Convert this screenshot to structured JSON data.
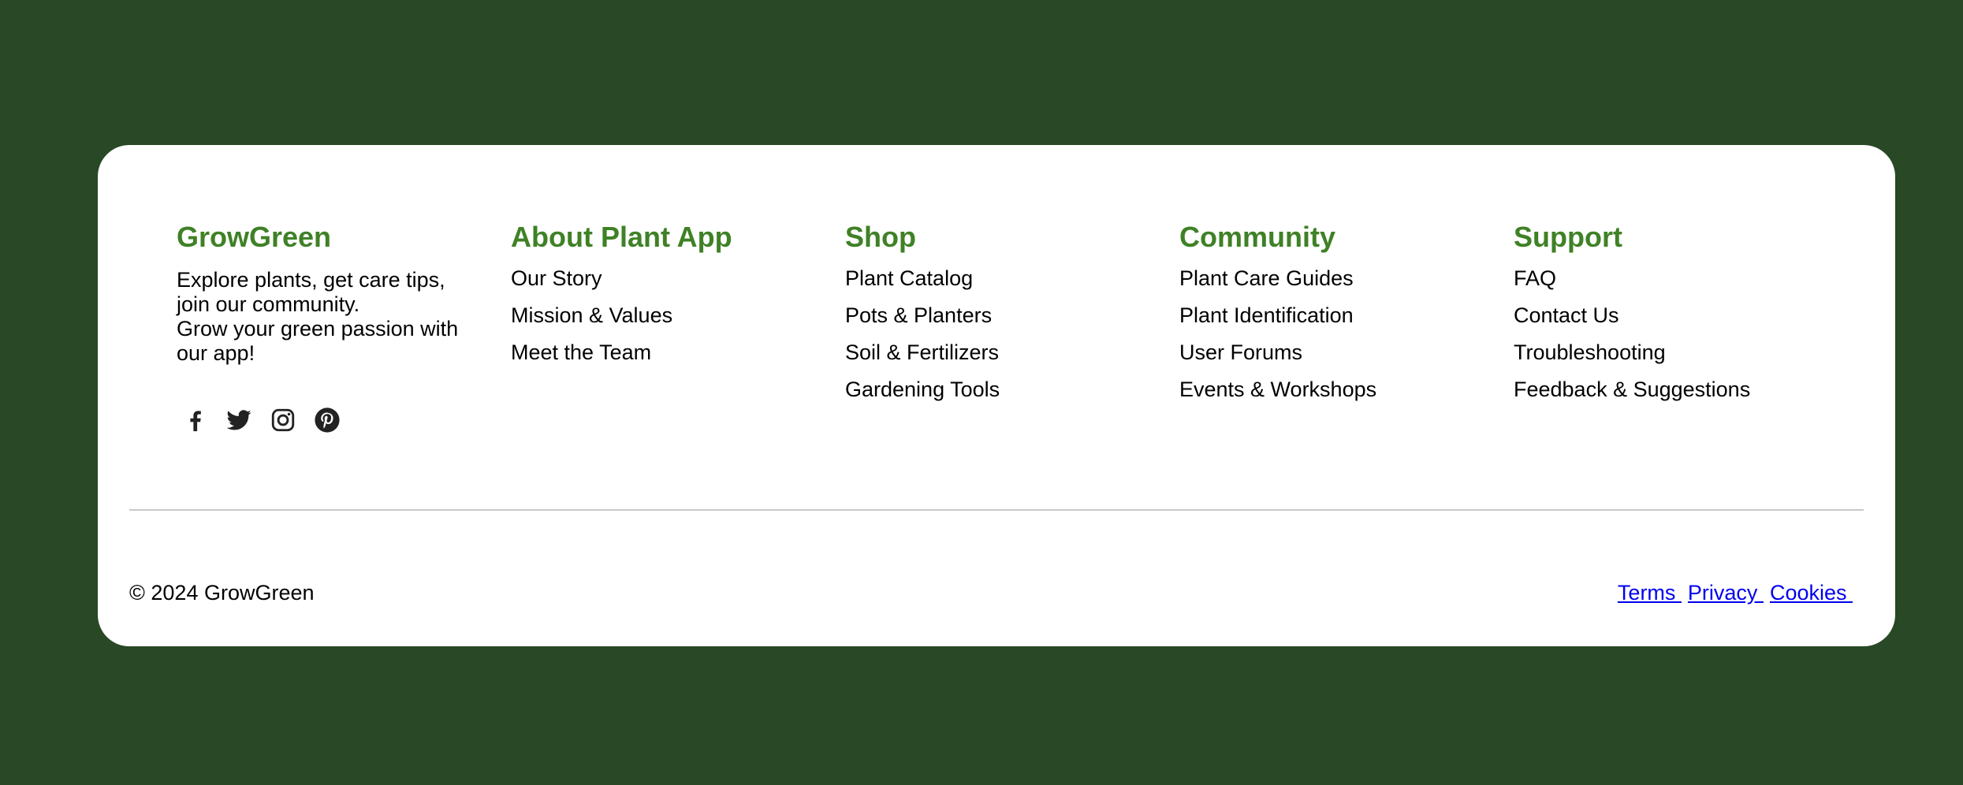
{
  "brand": {
    "name": "GrowGreen",
    "description_lines": [
      "Explore plants, get care tips, join our community.",
      "Grow your green passion with our app!"
    ],
    "social_icons": [
      "facebook-icon",
      "twitter-icon",
      "instagram-icon",
      "pinterest-icon"
    ]
  },
  "columns": [
    {
      "title": "About Plant App",
      "links": [
        "Our Story",
        "Mission & Values",
        "Meet the Team"
      ]
    },
    {
      "title": "Shop",
      "links": [
        "Plant Catalog",
        "Pots & Planters",
        "Soil & Fertilizers",
        "Gardening Tools"
      ]
    },
    {
      "title": "Community",
      "links": [
        "Plant Care Guides",
        "Plant Identification",
        "User Forums",
        "Events & Workshops"
      ]
    },
    {
      "title": "Support",
      "links": [
        "FAQ",
        "Contact Us",
        "Troubleshooting",
        "Feedback & Suggestions"
      ]
    }
  ],
  "bottom": {
    "copyright": "© 2024 GrowGreen",
    "legal_links": [
      "Terms ",
      "Privacy ",
      "Cookies "
    ]
  },
  "colors": {
    "page_background": "#284826",
    "card_background": "#ffffff",
    "heading_green": "#3f8126",
    "text": "#000000",
    "link_blue": "#0000ee",
    "divider": "#c9c9c9",
    "icon": "#222222"
  }
}
